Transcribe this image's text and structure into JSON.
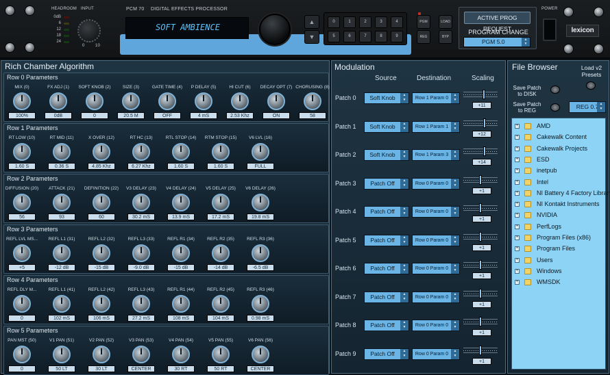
{
  "device": {
    "model": "PCM 70",
    "subtitle": "DIGITAL EFFECTS PROCESSOR",
    "display": "SOFT AMBIENCE",
    "brand": "lexicon",
    "headroom_label": "HEADROOM",
    "input_label": "INPUT",
    "power_label": "POWER",
    "meter_scale": [
      "0dB",
      "6",
      "12",
      "18",
      "24"
    ],
    "input_min": "0",
    "input_max": "10",
    "numkeys": [
      "0",
      "1",
      "2",
      "3",
      "4",
      "5",
      "6",
      "7",
      "8",
      "9"
    ],
    "pgm_label": "PGM",
    "load_label": "LOAD",
    "reg_label": "REG",
    "byp_label": "BYP",
    "active_prog_button": "ACTIVE PROG REQUEST",
    "program_change_label": "PROGRAM CHANGE",
    "program_value": "PGM 5.0"
  },
  "algo": {
    "title": "Rich Chamber Algorithm",
    "rows": [
      {
        "label": "Row 0 Parameters",
        "params": [
          {
            "name": "MIX (0)",
            "value": "100%"
          },
          {
            "name": "FX ADJ (1)",
            "value": "0dB"
          },
          {
            "name": "SOFT KNOB (2)",
            "value": "0"
          },
          {
            "name": "SIZE (3)",
            "value": "20.5 M"
          },
          {
            "name": "GATE TIME (4)",
            "value": "OFF"
          },
          {
            "name": "P DELAY (5)",
            "value": "4 mS"
          },
          {
            "name": "HI CUT (6)",
            "value": "2.53 Khz"
          },
          {
            "name": "DECAY OPT (7)",
            "value": "ON"
          },
          {
            "name": "CHORUSING (8)",
            "value": "58"
          }
        ]
      },
      {
        "label": "Row 1 Parameters",
        "params": [
          {
            "name": "RT LOW (10)",
            "value": "1.60 S"
          },
          {
            "name": "RT MID (11)",
            "value": "0.36 S"
          },
          {
            "name": "X OVER (12)",
            "value": "4.85 Khz"
          },
          {
            "name": "RT HC (13)",
            "value": "6.27 Khz"
          },
          {
            "name": "RTL STOP (14)",
            "value": "1.60 S"
          },
          {
            "name": "RTM STOP (15)",
            "value": "1.60 S"
          },
          {
            "name": "V6 LVL (16)",
            "value": "FULL"
          }
        ]
      },
      {
        "label": "Row 2 Parameters",
        "params": [
          {
            "name": "DIFFUSION (20)",
            "value": "56"
          },
          {
            "name": "ATTACK (21)",
            "value": "93"
          },
          {
            "name": "DEFINITION (22)",
            "value": "60"
          },
          {
            "name": "V3 DELAY (23)",
            "value": "30.2 mS"
          },
          {
            "name": "V4 DELAY (24)",
            "value": "13.9 mS"
          },
          {
            "name": "V5 DELAY (25)",
            "value": "17.2 mS"
          },
          {
            "name": "V6 DELAY (26)",
            "value": "19.8 mS"
          }
        ]
      },
      {
        "label": "Row 3 Parameters",
        "params": [
          {
            "name": "REFL LVL MS...",
            "value": "+5"
          },
          {
            "name": "REFL L1 (31)",
            "value": "-12 dB"
          },
          {
            "name": "REFL L2 (32)",
            "value": "-15 dB"
          },
          {
            "name": "REFL L3 (33)",
            "value": "-9.0 dB"
          },
          {
            "name": "REFL R1 (34)",
            "value": "-15 dB"
          },
          {
            "name": "REFL R2 (35)",
            "value": "-14 dB"
          },
          {
            "name": "REFL R3 (36)",
            "value": "-6.5 dB"
          }
        ]
      },
      {
        "label": "Row 4 Parameters",
        "params": [
          {
            "name": "REFL DLY M...",
            "value": "0"
          },
          {
            "name": "REFL L1 (41)",
            "value": "102 mS"
          },
          {
            "name": "REFL L2 (42)",
            "value": "106 mS"
          },
          {
            "name": "REFL L3 (43)",
            "value": "27.2 mS"
          },
          {
            "name": "REFL R1 (44)",
            "value": "108 mS"
          },
          {
            "name": "REFL R2 (45)",
            "value": "104 mS"
          },
          {
            "name": "REFL R3 (46)",
            "value": "0.98 mS"
          }
        ]
      },
      {
        "label": "Row 5 Parameters",
        "params": [
          {
            "name": "PAN MST (50)",
            "value": "0"
          },
          {
            "name": "V1 PAN (51)",
            "value": "50 LT"
          },
          {
            "name": "V2 PAN (52)",
            "value": "30 LT"
          },
          {
            "name": "V3 PAN (53)",
            "value": "CENTER"
          },
          {
            "name": "V4 PAN (54)",
            "value": "30 RT"
          },
          {
            "name": "V5 PAN (55)",
            "value": "50 RT"
          },
          {
            "name": "V6 PAN (56)",
            "value": "CENTER"
          }
        ]
      }
    ]
  },
  "modulation": {
    "title": "Modulation",
    "col_source": "Source",
    "col_destination": "Destination",
    "col_scaling": "Scaling",
    "patches": [
      {
        "label": "Patch 0",
        "source": "Soft Knob",
        "dest": "Row 1 Param 0",
        "scale": "+11",
        "level": 0.61
      },
      {
        "label": "Patch 1",
        "source": "Soft Knob",
        "dest": "Row 1 Param 1",
        "scale": "+12",
        "level": 0.62
      },
      {
        "label": "Patch 2",
        "source": "Soft Knob",
        "dest": "Row 1 Param 3",
        "scale": "+14",
        "level": 0.64
      },
      {
        "label": "Patch 3",
        "source": "Patch Off",
        "dest": "Row 0 Param 0",
        "scale": "+1",
        "level": 0.5
      },
      {
        "label": "Patch 4",
        "source": "Patch Off",
        "dest": "Row 0 Param 0",
        "scale": "+1",
        "level": 0.5
      },
      {
        "label": "Patch 5",
        "source": "Patch Off",
        "dest": "Row 0 Param 0",
        "scale": "+1",
        "level": 0.5
      },
      {
        "label": "Patch 6",
        "source": "Patch Off",
        "dest": "Row 0 Param 0",
        "scale": "+1",
        "level": 0.5
      },
      {
        "label": "Patch 7",
        "source": "Patch Off",
        "dest": "Row 0 Param 0",
        "scale": "+1",
        "level": 0.5
      },
      {
        "label": "Patch 8",
        "source": "Patch Off",
        "dest": "Row 0 Param 0",
        "scale": "+1",
        "level": 0.5
      },
      {
        "label": "Patch 9",
        "source": "Patch Off",
        "dest": "Row 0 Param 0",
        "scale": "+1",
        "level": 0.5
      }
    ]
  },
  "filebrowser": {
    "title": "File Browser",
    "load_label": "Load v2 Presets",
    "save_disk_label": "Save Patch to DISK",
    "save_reg_label": "Save Patch to REG",
    "reg_value": "REG 0.7",
    "items": [
      "AMD",
      "Cakewalk Content",
      "Cakewalk Projects",
      "ESD",
      "inetpub",
      "Intel",
      "NI Battery 4 Factory Library",
      "NI Kontakt Instruments",
      "NVIDIA",
      "PerfLogs",
      "Program Files (x86)",
      "Program Files",
      "Users",
      "Windows",
      "WMSDK"
    ]
  }
}
